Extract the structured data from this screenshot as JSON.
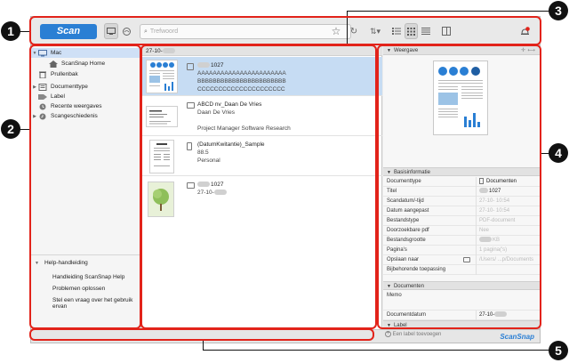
{
  "callouts": [
    "1",
    "2",
    "3",
    "4",
    "5"
  ],
  "toolbar": {
    "scan_label": "Scan",
    "search_placeholder": "Trefwoord",
    "icons": [
      "scanner-view-icon",
      "cloud-icon",
      "star-icon",
      "refresh-icon",
      "sort-icon",
      "list-view-icon",
      "thumbnail-view-icon",
      "detail-view-icon",
      "panel-icon",
      "notification-bell-icon"
    ],
    "notification_count": "1"
  },
  "sidebar": {
    "items": [
      {
        "label": "Mac",
        "icon": "computer-icon"
      },
      {
        "label": "ScanSnap Home",
        "icon": "home-icon"
      },
      {
        "label": "Prullenbak",
        "icon": "trash-icon"
      },
      {
        "label": "Documenttype",
        "icon": "document-type-icon"
      },
      {
        "label": "Label",
        "icon": "label-icon"
      },
      {
        "label": "Recente weergaves",
        "icon": "recent-icon"
      },
      {
        "label": "Scangeschiedenis",
        "icon": "history-icon"
      }
    ],
    "help": {
      "header": "Help-handleiding",
      "items": [
        "Handleiding ScanSnap Help",
        "Problemen oplossen",
        "Stel een vraag over het gebruik ervan"
      ]
    }
  },
  "list": {
    "date_header": "27-10-",
    "items": [
      {
        "line1": "1027",
        "line2": "AAAAAAAAAAAAAAAAAAAAAAA",
        "line3": "BBBBBBBBBBBBBBBBBBBBBBB",
        "line4": "CCCCCCCCCCCCCCCCCCCCC"
      },
      {
        "line1": "ABCD nv_Daan De Vries",
        "line2": "Daan De Vries",
        "line3": "Project Manager Software Research"
      },
      {
        "line1": "(DatumKwitantie)_Sample",
        "line2": "88.5",
        "line3": "Personal"
      },
      {
        "line1": "1027",
        "line2": "27-10-"
      }
    ]
  },
  "right": {
    "preview_header": "Weergave",
    "basis_header": "Basisinformatie",
    "props": [
      {
        "k": "Documenttype",
        "v": "Documenten"
      },
      {
        "k": "Titel",
        "v": "1027"
      },
      {
        "k": "Scandatum/-tijd",
        "v": "27-10-      10:54"
      },
      {
        "k": "Datum aangepast",
        "v": "27-10-      10:54"
      },
      {
        "k": "Bestandstype",
        "v": "PDF-document"
      },
      {
        "k": "Doorzoekbare pdf",
        "v": "Nee"
      },
      {
        "k": "Bestandsgrootte",
        "v": "KB"
      },
      {
        "k": "Pagina's",
        "v": "1 pagina('s)"
      },
      {
        "k": "Opslaan naar",
        "v": "/Users/      ...p/Documents"
      },
      {
        "k": "Bijbehorende toepassing",
        "v": ""
      }
    ],
    "documents_header": "Documenten",
    "memo_label": "Memo",
    "docdate_label": "Documentdatum",
    "docdate_value": "27-10-",
    "label_header": "Label",
    "add_label": "Een label toevoegen"
  },
  "status": {
    "brand": "ScanSnap"
  }
}
